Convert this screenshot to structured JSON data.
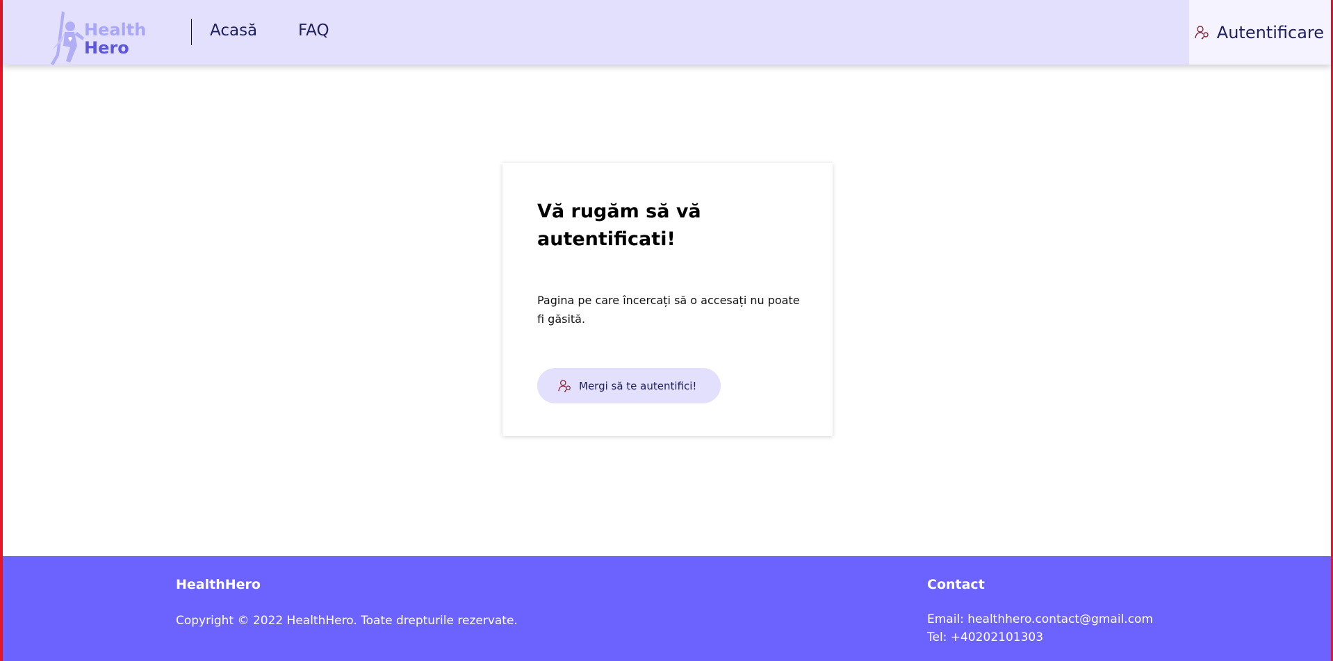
{
  "header": {
    "logo_line1": "Health",
    "logo_line2": "Hero",
    "nav": [
      {
        "label": "Acasă"
      },
      {
        "label": "FAQ"
      }
    ],
    "login_label": "Autentificare",
    "login_icon": "user-key-icon"
  },
  "card": {
    "title": "Vă rugăm să vă autentificati!",
    "message": "Pagina pe care încercați să o accesați nu poate fi găsită.",
    "button_label": "Mergi să te autentifici!"
  },
  "footer": {
    "brand_title": "HealthHero",
    "copyright": "Copyright © 2022 HealthHero. Toate drepturile rezervate.",
    "contact_title": "Contact",
    "email": "Email: healthhero.contact@gmail.com",
    "tel": "Tel: +40202101303"
  },
  "colors": {
    "header_bg": "#e3e0fe",
    "footer_bg": "#6c63ff",
    "text_dark": "#1f2160",
    "icon": "#8b2a3a"
  }
}
